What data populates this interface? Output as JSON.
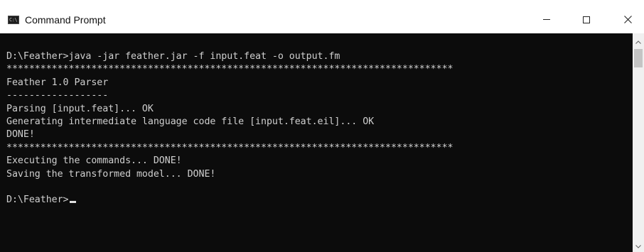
{
  "window": {
    "title": "Command Prompt",
    "icon": "cmd-icon",
    "icon_glyph": "C:\\"
  },
  "controls": {
    "minimize_icon": "minimize-icon",
    "maximize_icon": "maximize-icon",
    "close_icon": "close-icon"
  },
  "console": {
    "lines": [
      "",
      "D:\\Feather>java -jar feather.jar -f input.feat -o output.fm",
      "*******************************************************************************",
      "Feather 1.0 Parser",
      "------------------",
      "Parsing [input.feat]... OK",
      "Generating intermediate language code file [input.feat.eil]... OK",
      "DONE!",
      "*******************************************************************************",
      "Executing the commands... DONE!",
      "Saving the transformed model... DONE!",
      ""
    ],
    "prompt": "D:\\Feather>",
    "background": "#0c0c0c",
    "foreground": "#cccccc"
  },
  "scrollbar": {
    "up_icon": "scroll-up-arrow-icon",
    "down_icon": "scroll-down-arrow-icon"
  }
}
